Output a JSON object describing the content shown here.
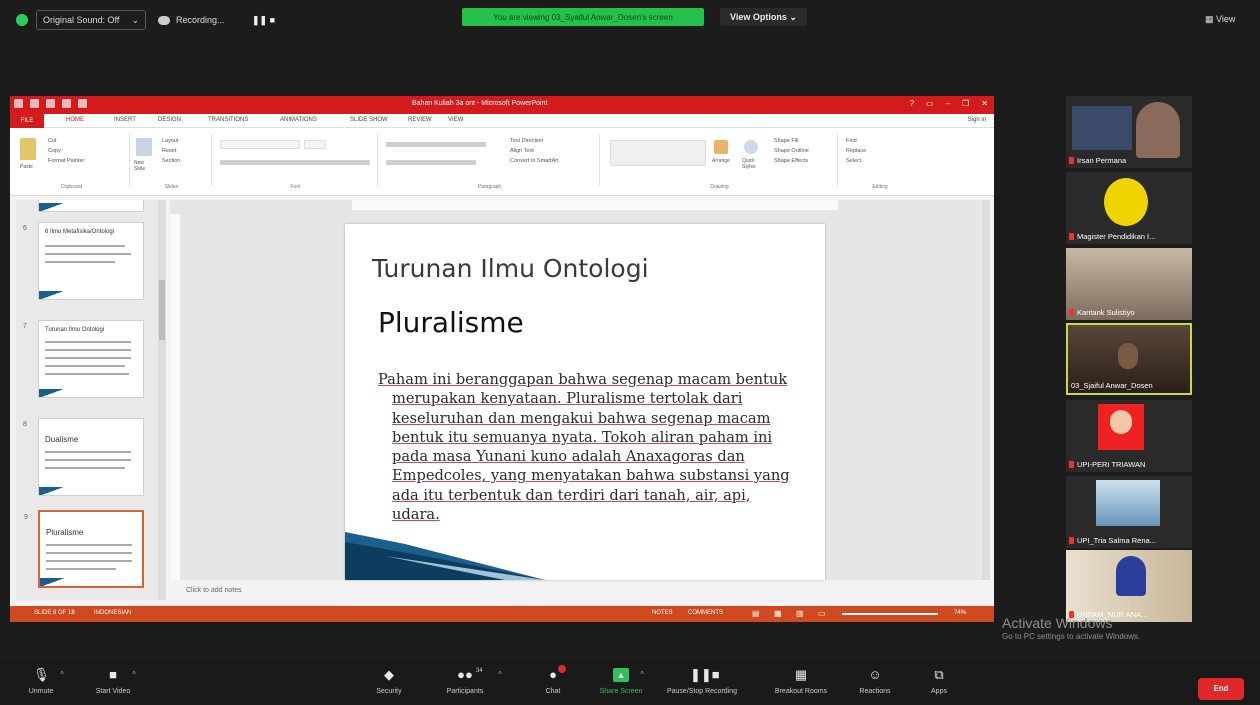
{
  "topbar": {
    "sound": "Original Sound: Off",
    "recording": "Recording...",
    "controls": "❚❚ ■",
    "viewing": "You are viewing 03_Syaiful Anwar_Dosen's screen",
    "view_options": "View Options ⌄",
    "view": "View"
  },
  "ppt": {
    "title": "Bahan Kuliah 3a ont - Microsoft PowerPoint",
    "tabs": [
      "FILE",
      "HOME",
      "INSERT",
      "DESIGN",
      "TRANSITIONS",
      "ANIMATIONS",
      "SLIDE SHOW",
      "REVIEW",
      "VIEW"
    ],
    "signin": "Sign in",
    "groups": {
      "clipboard": "Clipboard",
      "slides": "Slides",
      "font": "Font",
      "paragraph": "Paragraph",
      "drawing": "Drawing",
      "editing": "Editing"
    },
    "ribbon": {
      "cut": "Cut",
      "copy": "Copy",
      "paste": "Paste",
      "format_painter": "Format Painter",
      "layout": "Layout",
      "reset": "Reset",
      "section": "Section",
      "new_slide": "New Slide",
      "text_direction": "Text Direction",
      "align_text": "Align Text",
      "convert_smartart": "Convert to SmartArt",
      "arrange": "Arrange",
      "quick_styles": "Quick Styles",
      "shape_fill": "Shape Fill",
      "shape_outline": "Shape Outline",
      "shape_effects": "Shape Effects",
      "find": "Find",
      "replace": "Replace",
      "select": "Select"
    },
    "thumbs": [
      {
        "num": "6",
        "title": "6 Ilmu Metafisika/Ontologi"
      },
      {
        "num": "7",
        "title": "Turunan Ilmu Ontologi"
      },
      {
        "num": "8",
        "title": "Dualisme"
      },
      {
        "num": "9",
        "title": "Pluralisme"
      }
    ],
    "slide": {
      "title": "Turunan Ilmu Ontologi",
      "heading": "Pluralisme",
      "body": "Paham ini beranggapan bahwa segenap macam bentuk merupakan kenyataan. Pluralisme tertolak dari keseluruhan dan mengakui bahwa segenap macam bentuk itu semuanya nyata. Tokoh aliran paham ini pada masa Yunani kuno adalah Anaxagoras dan Empedcoles, yang menyatakan bahwa substansi yang ada itu terbentuk dan terdiri dari tanah, air, api, udara."
    },
    "notes_placeholder": "Click to add notes",
    "status": {
      "slide_of": "SLIDE 9 OF 18",
      "language": "INDONESIAN",
      "notes": "NOTES",
      "comments": "COMMENTS",
      "zoom": "74%"
    }
  },
  "participants": [
    {
      "name": "Irsan Permana"
    },
    {
      "name": "Magister Pendidikan I..."
    },
    {
      "name": "Kantank Sulistiyo"
    },
    {
      "name": "03_Sjaiful Anwar_Dosen"
    },
    {
      "name": "UPI-PERI TRIAWAN"
    },
    {
      "name": "UPI_Tria Salma Rena..."
    },
    {
      "name": "UNPAM_NUR ANA..."
    }
  ],
  "activate": {
    "line1": "Activate Windows",
    "line2": "Go to PC settings to activate Windows."
  },
  "toolbar": {
    "unmute": "Unmute",
    "start_video": "Start Video",
    "security": "Security",
    "participants": "Participants",
    "participants_count": "34",
    "chat": "Chat",
    "share_screen": "Share Screen",
    "pause_recording": "Pause/Stop Recording",
    "breakout": "Breakout Rooms",
    "reactions": "Reactions",
    "apps": "Apps",
    "end": "End"
  },
  "colors": {
    "ppt_red": "#d31b1b",
    "zoom_green": "#2ec15a",
    "end_red": "#e02828",
    "active_speaker": "#c7d94a"
  }
}
